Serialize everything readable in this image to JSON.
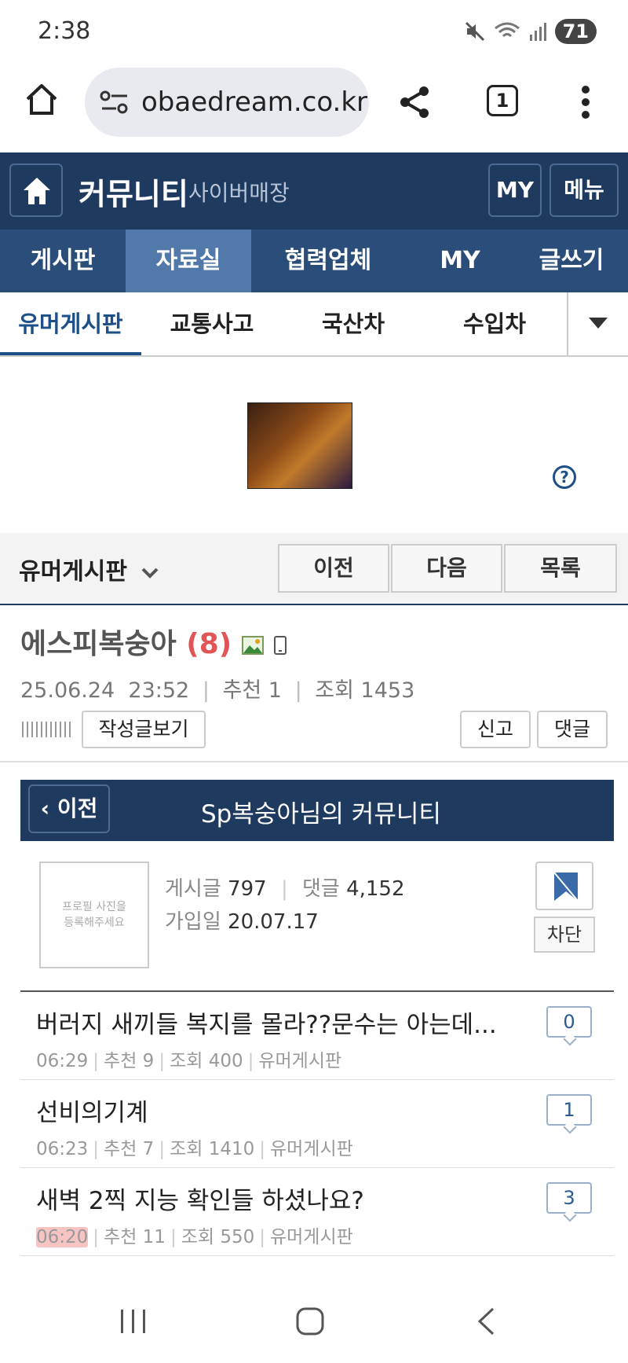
{
  "status_bar": {
    "time": "2:38",
    "battery": "71"
  },
  "browser": {
    "url": "obaedream.co.kr",
    "tab_count": "1"
  },
  "site_header": {
    "title": "커뮤니티",
    "subtitle": "사이버매장",
    "my_label": "MY",
    "menu_label": "메뉴"
  },
  "main_tabs": [
    {
      "label": "게시판"
    },
    {
      "label": "자료실"
    },
    {
      "label": "협력업체"
    },
    {
      "label": "MY"
    },
    {
      "label": "글쓰기"
    }
  ],
  "sub_tabs": [
    {
      "label": "유머게시판"
    },
    {
      "label": "교통사고"
    },
    {
      "label": "국산차"
    },
    {
      "label": "수입차"
    }
  ],
  "board_bar": {
    "board_name": "유머게시판",
    "prev": "이전",
    "next": "다음",
    "list": "목록"
  },
  "post": {
    "author": "에스피복숭아",
    "author_count": "(8)",
    "date": "25.06.24",
    "time": "23:52",
    "recommend": "추천 1",
    "views": "조회 1453",
    "view_posts": "작성글보기",
    "report": "신고",
    "comment": "댓글"
  },
  "community": {
    "back": "이전",
    "title": "Sp복숭아님의 커뮤니티",
    "profile_placeholder_1": "프로필 사진을",
    "profile_placeholder_2": "등록해주세요",
    "posts_label": "게시글",
    "posts_value": "797",
    "comments_label": "댓글",
    "comments_value": "4,152",
    "joined_label": "가입일",
    "joined_value": "20.07.17",
    "block": "차단"
  },
  "list": [
    {
      "title": "버러지 새끼들 복지를 몰라??문수는 아는데...",
      "time": "06:29",
      "recommend": "추천 9",
      "views": "조회 400",
      "board": "유머게시판",
      "comments": "0"
    },
    {
      "title": "선비의기계",
      "time": "06:23",
      "recommend": "추천 7",
      "views": "조회 1410",
      "board": "유머게시판",
      "comments": "1"
    },
    {
      "title": "새벽 2찍 지능 확인들 하셨나요?",
      "time": "06:20",
      "recommend": "추천 11",
      "views": "조회 550",
      "board": "유머게시판",
      "comments": "3"
    }
  ],
  "colors": {
    "header": "#1f3a5f",
    "tabs": "#2b4d7a",
    "active_tab": "#5179aa",
    "accent_red": "#e25555"
  }
}
